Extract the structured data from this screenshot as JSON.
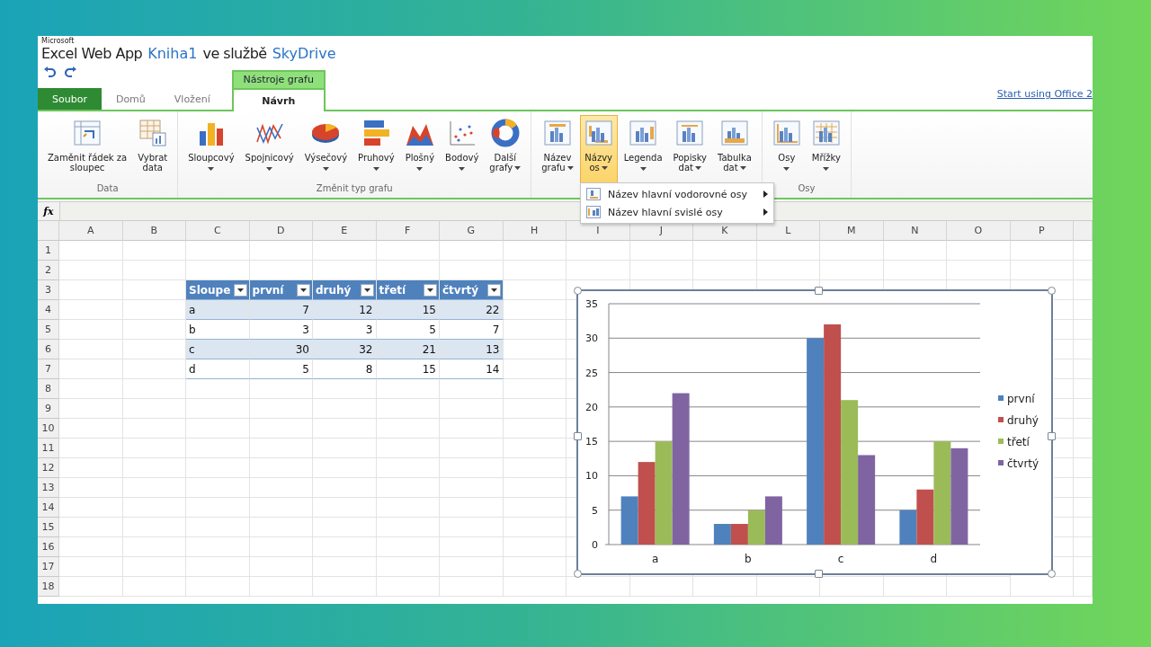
{
  "app": {
    "brand": "Microsoft",
    "product": "Excel Web App",
    "document": "Kniha1",
    "connector": "ve službě",
    "service": "SkyDrive"
  },
  "quick_access": [
    {
      "kind": "undo"
    },
    {
      "kind": "redo"
    }
  ],
  "contextual_tab": {
    "label": "Nástroje grafu"
  },
  "tabs": [
    {
      "label": "Soubor",
      "kind": "file",
      "selected": false
    },
    {
      "label": "Domů",
      "kind": "normal",
      "selected": false
    },
    {
      "label": "Vložení",
      "kind": "normal",
      "selected": false
    },
    {
      "label": "Návrh",
      "kind": "contextual",
      "selected": true
    }
  ],
  "office_link": "Start using Office 2",
  "ribbon_groups": [
    {
      "label": "Data",
      "buttons": [
        {
          "lines": [
            "Zaměnit řádek za",
            "sloupec"
          ],
          "kind": "swap",
          "dropdown": false,
          "selected": false
        },
        {
          "lines": [
            "Vybrat",
            "data"
          ],
          "kind": "select-data",
          "dropdown": false,
          "selected": false
        }
      ]
    },
    {
      "label": "Změnit typ grafu",
      "buttons": [
        {
          "lines": [
            "Sloupcový"
          ],
          "kind": "column",
          "dropdown": true,
          "selected": false
        },
        {
          "lines": [
            "Spojnicový"
          ],
          "kind": "line",
          "dropdown": true,
          "selected": false
        },
        {
          "lines": [
            "Výsečový"
          ],
          "kind": "pie",
          "dropdown": true,
          "selected": false
        },
        {
          "lines": [
            "Pruhový"
          ],
          "kind": "bar",
          "dropdown": true,
          "selected": false
        },
        {
          "lines": [
            "Plošný"
          ],
          "kind": "area",
          "dropdown": true,
          "selected": false
        },
        {
          "lines": [
            "Bodový"
          ],
          "kind": "scatter",
          "dropdown": true,
          "selected": false
        },
        {
          "lines": [
            "Další",
            "grafy"
          ],
          "kind": "donut",
          "dropdown": true,
          "selected": false
        }
      ]
    },
    {
      "buttons": [
        {
          "lines": [
            "Název",
            "grafu"
          ],
          "kind": "chart-title",
          "dropdown": true,
          "selected": false
        },
        {
          "lines": [
            "Názvy",
            "os"
          ],
          "kind": "axis-titles",
          "dropdown": true,
          "selected": true
        },
        {
          "lines": [
            "Legenda"
          ],
          "kind": "legend",
          "dropdown": true,
          "selected": false
        },
        {
          "lines": [
            "Popisky",
            "dat"
          ],
          "kind": "data-labels",
          "dropdown": true,
          "selected": false
        },
        {
          "lines": [
            "Tabulka",
            "dat"
          ],
          "kind": "data-table",
          "dropdown": true,
          "selected": false
        }
      ]
    },
    {
      "label": "Osy",
      "buttons": [
        {
          "lines": [
            "Osy"
          ],
          "kind": "axes",
          "dropdown": true,
          "selected": false
        },
        {
          "lines": [
            "Mřížky"
          ],
          "kind": "gridlines",
          "dropdown": true,
          "selected": false
        }
      ]
    }
  ],
  "dropdown_menu": {
    "items": [
      {
        "label": "Název hlavní vodorovné osy",
        "kind": "horizontal-title",
        "submenu": true
      },
      {
        "label": "Název hlavní svislé osy",
        "kind": "vertical-title",
        "submenu": true
      }
    ]
  },
  "formula_bar": {
    "label": "fx"
  },
  "sheet": {
    "columns": [
      "A",
      "B",
      "C",
      "D",
      "E",
      "F",
      "G",
      "H",
      "I",
      "J",
      "K",
      "L",
      "M",
      "N",
      "O",
      "P"
    ],
    "rows": [
      "1",
      "2",
      "3",
      "4",
      "5",
      "6",
      "7",
      "8",
      "9",
      "10",
      "11",
      "12",
      "13",
      "14",
      "15",
      "16",
      "17",
      "18"
    ],
    "table": {
      "header": [
        "Sloupe",
        "první",
        "druhý",
        "třetí",
        "čtvrtý"
      ],
      "rows": [
        [
          "a",
          "7",
          "12",
          "15",
          "22"
        ],
        [
          "b",
          "3",
          "3",
          "5",
          "7"
        ],
        [
          "c",
          "30",
          "32",
          "21",
          "13"
        ],
        [
          "d",
          "5",
          "8",
          "15",
          "14"
        ]
      ]
    }
  },
  "chart": {
    "chart_data": {
      "type": "bar",
      "categories": [
        "a",
        "b",
        "c",
        "d"
      ],
      "series": [
        {
          "name": "první",
          "color": "#4f81bd",
          "values": [
            7,
            3,
            30,
            5
          ]
        },
        {
          "name": "druhý",
          "color": "#c0504d",
          "values": [
            12,
            3,
            32,
            8
          ]
        },
        {
          "name": "třetí",
          "color": "#9bbb59",
          "values": [
            15,
            5,
            21,
            15
          ]
        },
        {
          "name": "čtvrtý",
          "color": "#8064a2",
          "values": [
            22,
            7,
            13,
            14
          ]
        }
      ],
      "ylim": [
        0,
        35
      ],
      "yticks": [
        0,
        5,
        10,
        15,
        20,
        25,
        30,
        35
      ],
      "grid": true,
      "legend": true
    }
  }
}
